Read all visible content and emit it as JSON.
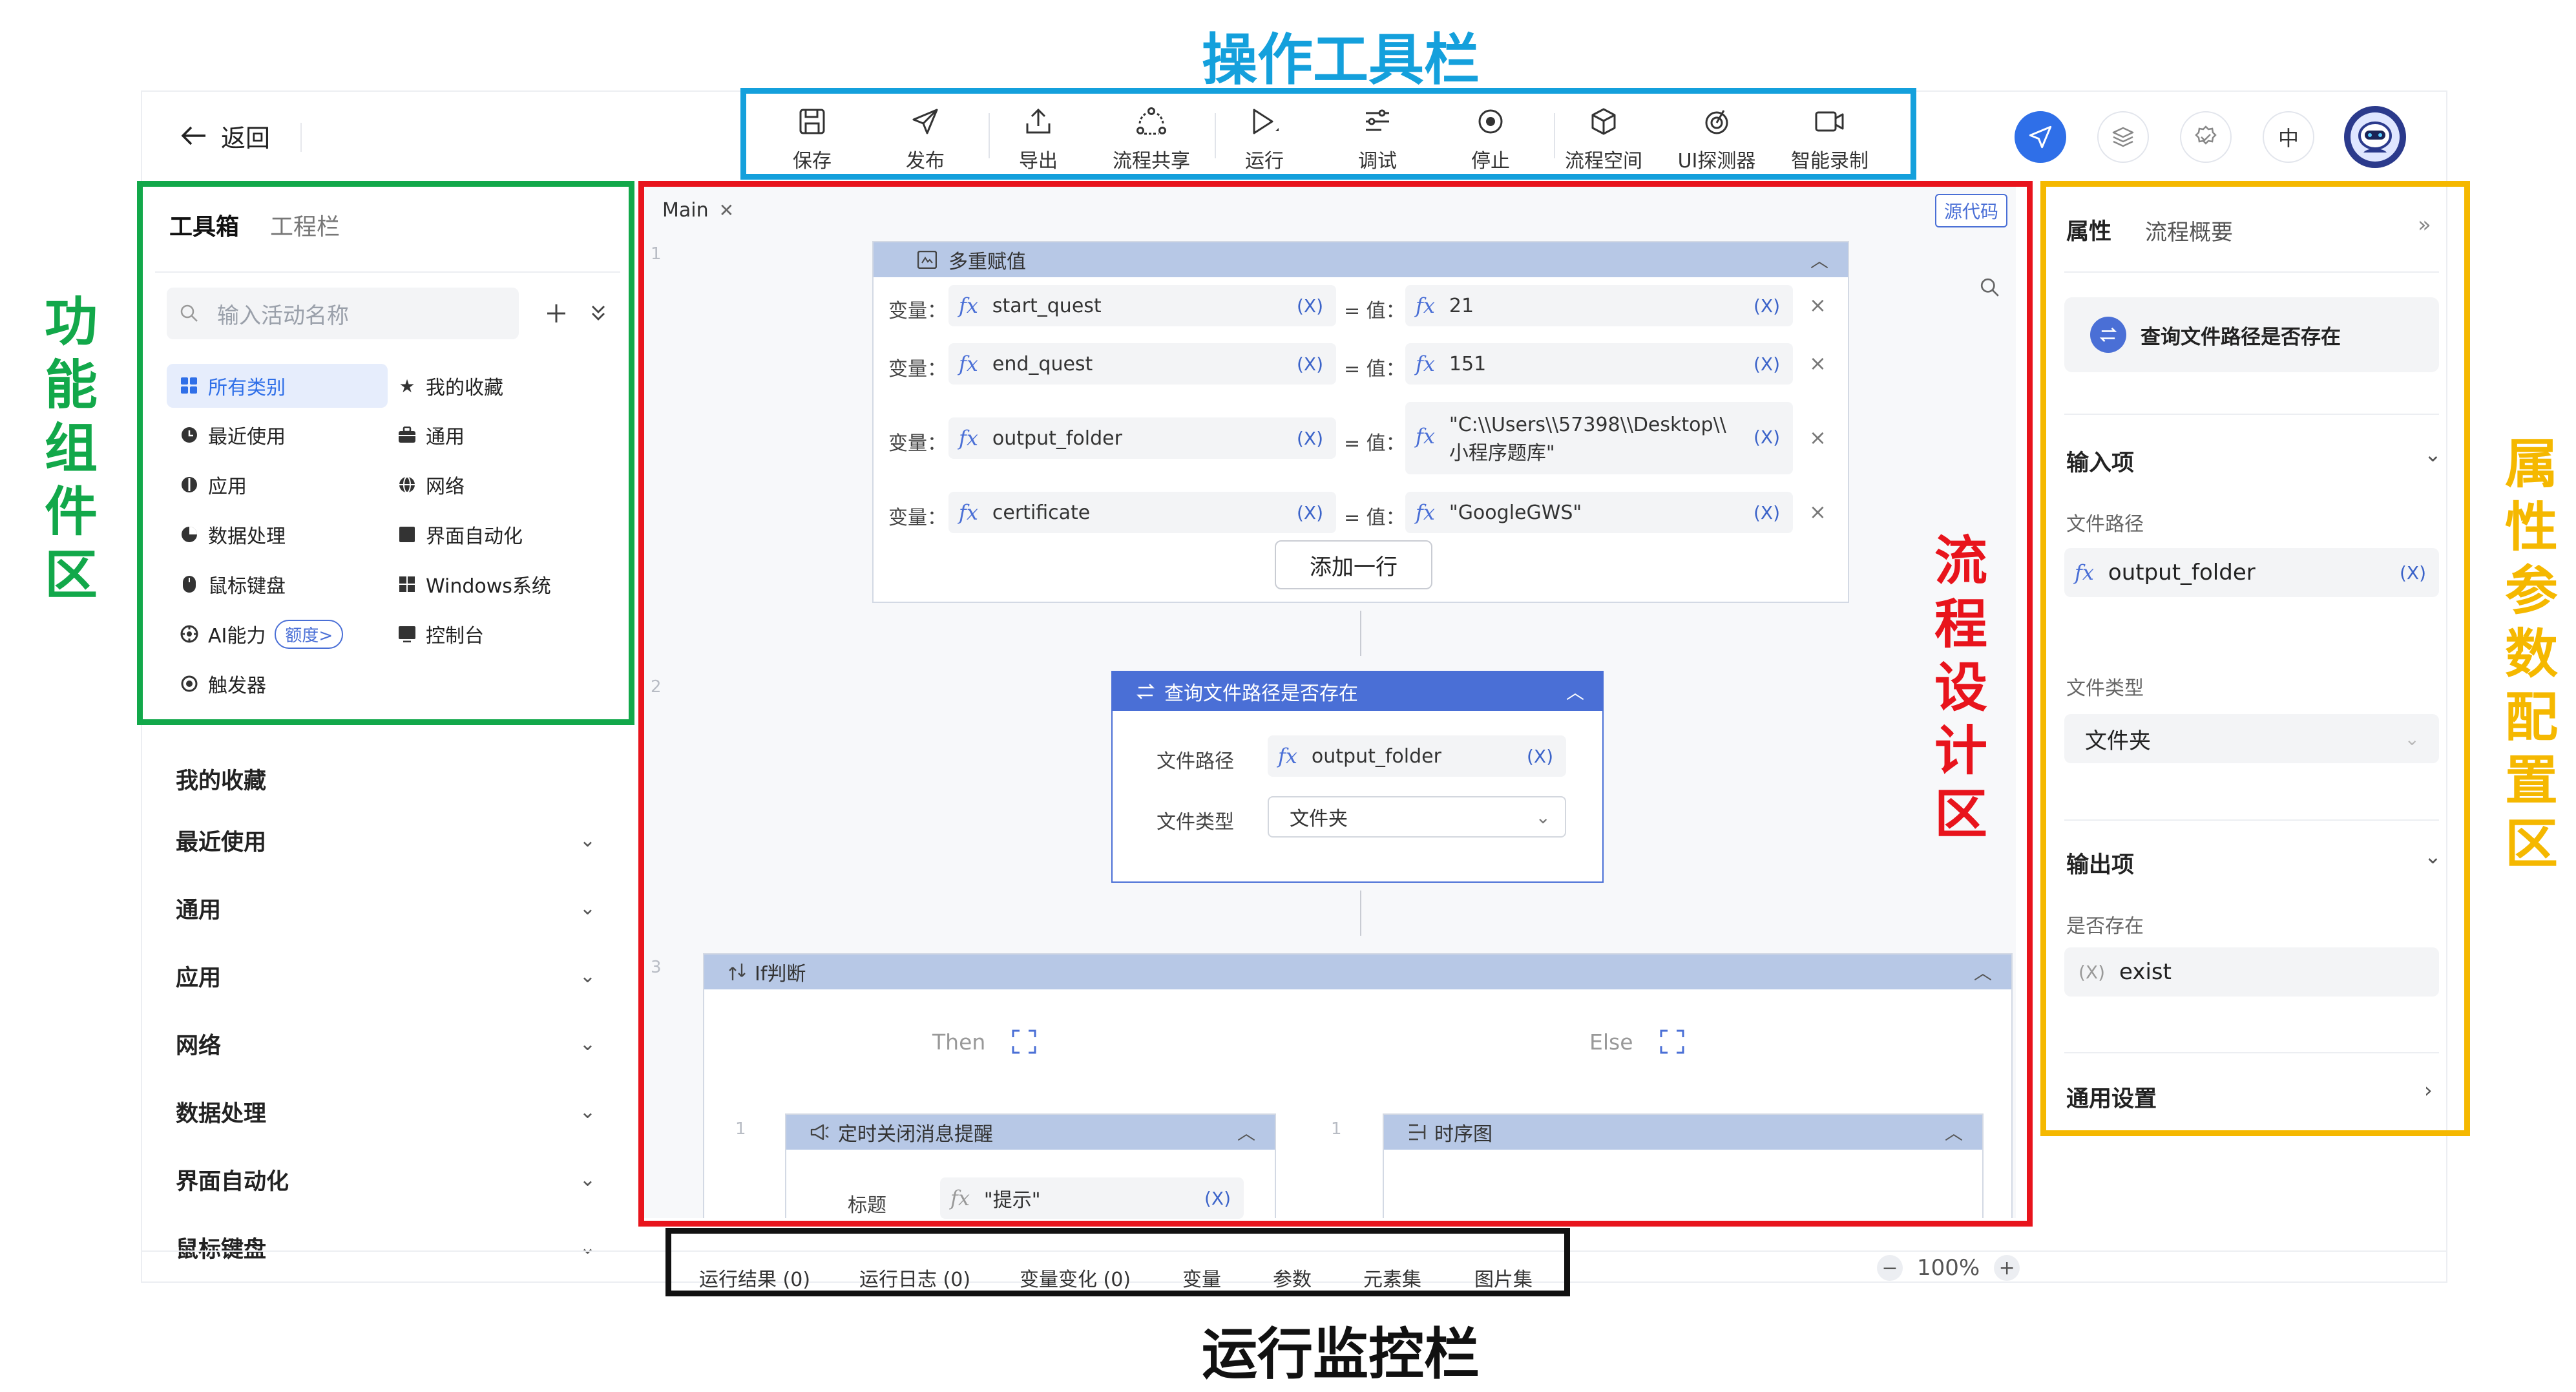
{
  "annotations": {
    "toolbar_title": "操作工具栏",
    "left_title": "功能组件区",
    "canvas_title": "流程设计区",
    "right_title": "属性参数配置区",
    "bottom_title": "运行监控栏",
    "colors": {
      "toolbar": "#14a0dc",
      "left": "#12a84a",
      "canvas": "#e8141c",
      "right": "#f5b800",
      "bottom": "#111111"
    }
  },
  "topbar": {
    "back_label": "返回",
    "toolbar": [
      {
        "label": "保存",
        "icon": "save-icon"
      },
      {
        "label": "发布",
        "icon": "send-icon"
      },
      {
        "label": "导出",
        "icon": "export-icon"
      },
      {
        "label": "流程共享",
        "icon": "share-icon"
      },
      {
        "label": "运行",
        "icon": "play-icon"
      },
      {
        "label": "调试",
        "icon": "debug-icon"
      },
      {
        "label": "停止",
        "icon": "stop-icon"
      },
      {
        "label": "流程空间",
        "icon": "cube-icon"
      },
      {
        "label": "UI探测器",
        "icon": "detector-icon"
      },
      {
        "label": "智能录制",
        "icon": "record-icon"
      }
    ],
    "lang_label": "中",
    "accent_color": "#2f6fe8"
  },
  "left_panel": {
    "tabs": [
      "工具箱",
      "工程栏"
    ],
    "search_placeholder": "输入活动名称",
    "categories": [
      {
        "label": "所有类别",
        "icon": "grid-icon",
        "selected": true
      },
      {
        "label": "我的收藏",
        "icon": "star-icon"
      },
      {
        "label": "最近使用",
        "icon": "clock-icon"
      },
      {
        "label": "通用",
        "icon": "briefcase-icon"
      },
      {
        "label": "应用",
        "icon": "app-icon"
      },
      {
        "label": "网络",
        "icon": "globe-icon"
      },
      {
        "label": "数据处理",
        "icon": "pie-icon"
      },
      {
        "label": "界面自动化",
        "icon": "window-icon"
      },
      {
        "label": "鼠标键盘",
        "icon": "mouse-icon"
      },
      {
        "label": "Windows系统",
        "icon": "windows-icon"
      },
      {
        "label": "AI能力",
        "icon": "ai-icon",
        "badge": "额度>"
      },
      {
        "label": "控制台",
        "icon": "console-icon"
      },
      {
        "label": "触发器",
        "icon": "target-icon"
      }
    ],
    "accordion": [
      "我的收藏",
      "最近使用",
      "通用",
      "应用",
      "网络",
      "数据处理",
      "界面自动化",
      "鼠标键盘"
    ]
  },
  "canvas": {
    "tab_label": "Main",
    "source_label": "源代码",
    "multi_assign": {
      "title": "多重赋值",
      "rows": [
        {
          "var_label": "变量：",
          "var": "start_quest",
          "val_label": "= 值：",
          "value": "21"
        },
        {
          "var_label": "变量：",
          "var": "end_quest",
          "val_label": "= 值：",
          "value": "151"
        },
        {
          "var_label": "变量：",
          "var": "output_folder",
          "val_label": "= 值：",
          "value": "\"C:\\\\Users\\\\57398\\\\Desktop\\\\",
          "value2": "小程序题库\""
        },
        {
          "var_label": "变量：",
          "var": "certificate",
          "val_label": "= 值：",
          "value": "\"GoogleGWS\""
        }
      ],
      "add_row": "添加一行"
    },
    "file_check": {
      "title": "查询文件路径是否存在",
      "path_label": "文件路径",
      "path_value": "output_folder",
      "type_label": "文件类型",
      "type_value": "文件夹"
    },
    "if_block": {
      "title": "If判断",
      "then": "Then",
      "else": "Else",
      "then_child": {
        "title": "定时关闭消息提醒",
        "field_label": "标题",
        "field_value": "\"提示\""
      },
      "else_child": {
        "title": "时序图"
      }
    },
    "var_tag": "(X)"
  },
  "right_panel": {
    "tabs": [
      "属性",
      "流程概要"
    ],
    "activity_name": "查询文件路径是否存在",
    "input_section": "输入项",
    "path_label": "文件路径",
    "path_value": "output_folder",
    "type_label": "文件类型",
    "type_value": "文件夹",
    "output_section": "输出项",
    "exist_label": "是否存在",
    "exist_value": "exist",
    "general_settings": "通用设置"
  },
  "bottom_bar": {
    "tabs": [
      "运行结果 (0)",
      "运行日志 (0)",
      "变量变化 (0)",
      "变量",
      "参数",
      "元素集",
      "图片集"
    ],
    "zoom": "100%"
  }
}
